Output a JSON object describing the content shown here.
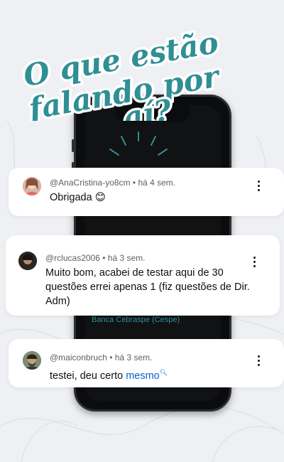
{
  "headline": {
    "line1": "O que estão",
    "line2": "falando por",
    "line3": "aí?"
  },
  "phone": {
    "caption": "Banca Cebraspe (Cespe)"
  },
  "comments": [
    {
      "author": "@AnaCristina-yo8cm",
      "time": "há 4 sem.",
      "text": "Obrigada",
      "emoji": "😊"
    },
    {
      "author": "@rclucas2006",
      "time": "há 3 sem.",
      "text": "Muito bom, acabei de testar aqui de 30 questões errei apenas 1 (fiz questões de Dir. Adm)"
    },
    {
      "author": "@maiconbruch",
      "time": "há 3 sem.",
      "text": "testei, deu certo",
      "highlight": "mesmo"
    }
  ],
  "colors": {
    "accent": "#2f8f95",
    "link": "#065fd4"
  },
  "icons": [
    "more-vert-icon",
    "search-icon"
  ]
}
